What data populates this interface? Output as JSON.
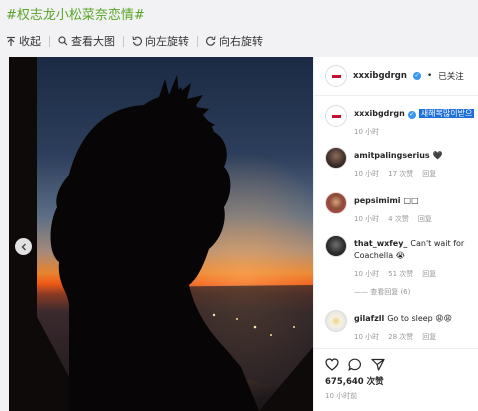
{
  "hashtag": "#权志龙小松菜奈恋情#",
  "toolbar": {
    "collapse": "收起",
    "view_large": "查看大图",
    "rotate_left": "向左旋转",
    "rotate_right": "向右旋转"
  },
  "post": {
    "username": "xxxibgdrgn",
    "follow_label": "已关注",
    "dot": "•",
    "caption_user": "xxxibgdrgn",
    "caption_text": "새해복많이받으",
    "caption_time": "10 小时",
    "comments": [
      {
        "user": "amitpalingserius",
        "text": "🖤",
        "time": "10 小时",
        "likes": "17 次赞",
        "reply": "回复"
      },
      {
        "user": "pepsimimi",
        "text": "□□",
        "time": "10 小时",
        "likes": "4 次赞",
        "reply": "回复"
      },
      {
        "user": "that_wxfey_",
        "text": "Can't wait for Coachella 😭",
        "time": "10 小时",
        "likes": "51 次赞",
        "reply": "回复",
        "view_replies": "—— 查看回复 (6)"
      },
      {
        "user": "gilafzll",
        "text": "Go to sleep 😩😩",
        "time": "10 小时",
        "likes": "28 次赞",
        "reply": "回复"
      }
    ],
    "likes_count": "675,640 次赞",
    "post_time": "10 小时前"
  },
  "colors": {
    "hashtag": "#5aa528",
    "verified": "#3897f0",
    "highlight": "#1e6fd8"
  }
}
